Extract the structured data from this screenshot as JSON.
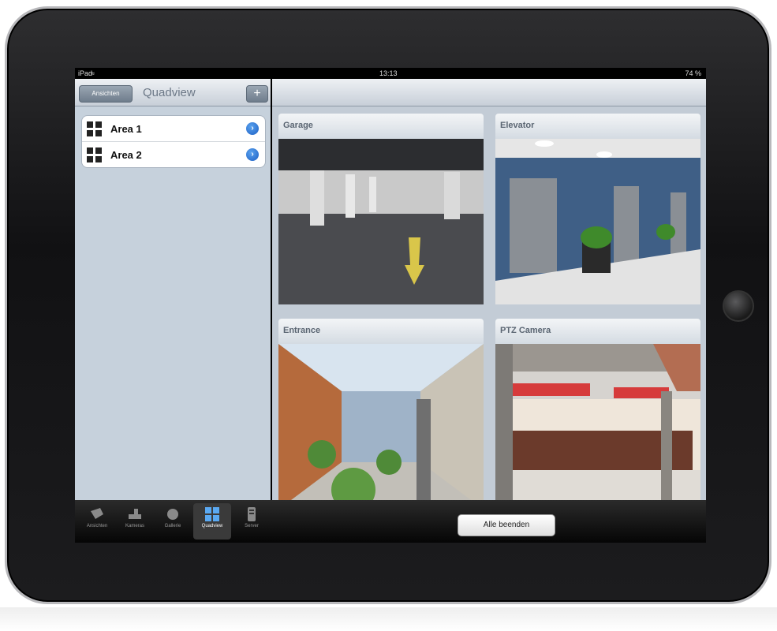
{
  "status_bar": {
    "carrier": "iPad",
    "time": "13:13",
    "battery": "74 %"
  },
  "sidebar": {
    "back_label": "Ansichten",
    "title": "Quadview",
    "add_label": "+",
    "items": [
      {
        "label": "Area 1",
        "icon": "grid-icon"
      },
      {
        "label": "Area 2",
        "icon": "grid-icon"
      }
    ]
  },
  "cameras": [
    {
      "title": "Garage"
    },
    {
      "title": "Elevator"
    },
    {
      "title": "Entrance"
    },
    {
      "title": "PTZ Camera"
    }
  ],
  "tab_bar": {
    "tabs": [
      {
        "label": "Ansichten",
        "icon": "views-icon",
        "active": false
      },
      {
        "label": "Kameras",
        "icon": "camera-icon",
        "active": false
      },
      {
        "label": "Gallerie",
        "icon": "gallery-icon",
        "active": false
      },
      {
        "label": "Quadview",
        "icon": "quadview-icon",
        "active": true
      },
      {
        "label": "Server",
        "icon": "server-icon",
        "active": false
      }
    ],
    "end_all_label": "Alle beenden"
  }
}
